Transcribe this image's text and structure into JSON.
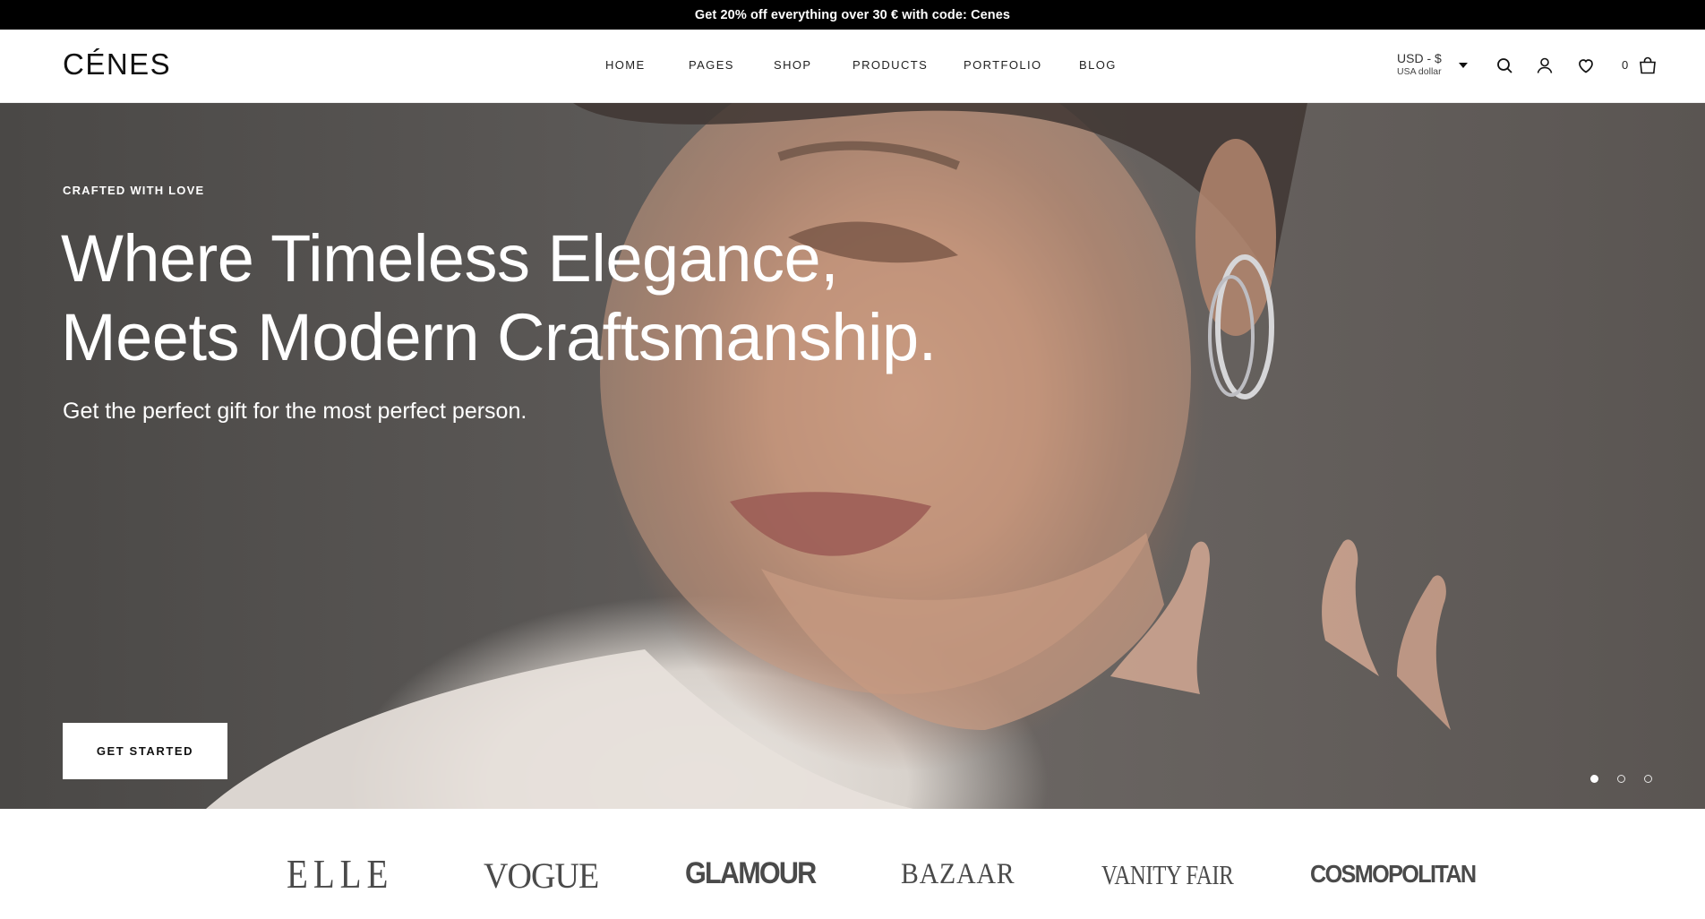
{
  "announcement": {
    "text": "Get 20% off everything over 30 € with code: Cenes"
  },
  "header": {
    "logo": "CÉNES",
    "nav": [
      {
        "label": "HOME"
      },
      {
        "label": "PAGES"
      },
      {
        "label": "SHOP"
      },
      {
        "label": "PRODUCTS"
      },
      {
        "label": "PORTFOLIO"
      },
      {
        "label": "BLOG"
      }
    ],
    "currency": {
      "code": "USD - $",
      "name": "USA dollar"
    },
    "cart_count": "0",
    "icons": [
      "search-icon",
      "user-icon",
      "heart-icon",
      "bag-icon"
    ]
  },
  "hero": {
    "eyebrow": "CRAFTED WITH LOVE",
    "headline_line1": "Where Timeless Elegance,",
    "headline_line2": "Meets Modern Craftsmanship.",
    "subhead": "Get the perfect gift for the most perfect person.",
    "cta": "GET STARTED",
    "slides_total": 3,
    "active_slide": 1
  },
  "brands": [
    {
      "name": "ELLE"
    },
    {
      "name": "VOGUE"
    },
    {
      "name": "GLAMOUR"
    },
    {
      "name": "BAZAAR"
    },
    {
      "name": "VANITY FAIR"
    },
    {
      "name": "COSMOPOLITAN"
    }
  ],
  "colors": {
    "announcement_bg": "#000000",
    "text_dark": "#111111",
    "hero_text": "#ffffff"
  }
}
